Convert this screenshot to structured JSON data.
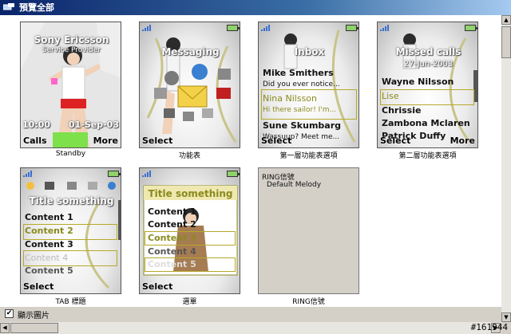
{
  "window": {
    "title": "預覽全部"
  },
  "thumbnails": [
    {
      "caption": "Standby",
      "header": "Sony Ericsson",
      "subheader": "Service Provider",
      "time": "10:00",
      "date": "01-Sep-03",
      "left_soft": "Calls",
      "right_soft": "More"
    },
    {
      "caption": "功能表",
      "header": "Messaging",
      "left_soft": "Select"
    },
    {
      "caption": "第一層功能表選項",
      "header": "Inbox",
      "lines": [
        "Mike Smithers",
        "Did you ever notice...",
        "Nina Nilsson",
        "Hi there sailor! I'm...",
        "Sune Skumbarg",
        "Wassuup?  Meet me..."
      ],
      "left_soft": "Select"
    },
    {
      "caption": "第二層功能表選項",
      "header": "Missed calls",
      "subheader": "27-Jun-2003",
      "lines": [
        "Wayne Nilsson",
        "Lise",
        "Chrissie",
        "Zambona Mclaren",
        "Patrick Duffy"
      ],
      "left_soft": "Select",
      "right_soft": "More"
    },
    {
      "caption": "TAB 標題",
      "header": "Title something",
      "lines": [
        "Content 1",
        "Content 2",
        "Content 3",
        "Content 4",
        "Content 5"
      ],
      "left_soft": "Select"
    },
    {
      "caption": "選單",
      "header": "Title something",
      "lines": [
        "Content 1",
        "Content 2",
        "Content 3",
        "Content 4",
        "Content 5"
      ],
      "left_soft": "Select"
    },
    {
      "caption": "RING信號",
      "lines": [
        "RING信號",
        "Default Melody"
      ]
    }
  ],
  "status": {
    "checkbox_label": "顯示圖片",
    "checked": true,
    "check_mark": "✔"
  },
  "scroll": {
    "up": "▲",
    "down": "▼",
    "left": "◀",
    "right": "▶"
  },
  "watermark": "#161944",
  "colors": {
    "highlight": "#b5a92b",
    "title_bar": "#0a246a",
    "battery": "#8fd16a"
  },
  "icons": [
    "signal-icon",
    "battery-icon",
    "window-app-icon",
    "messaging-icons"
  ]
}
